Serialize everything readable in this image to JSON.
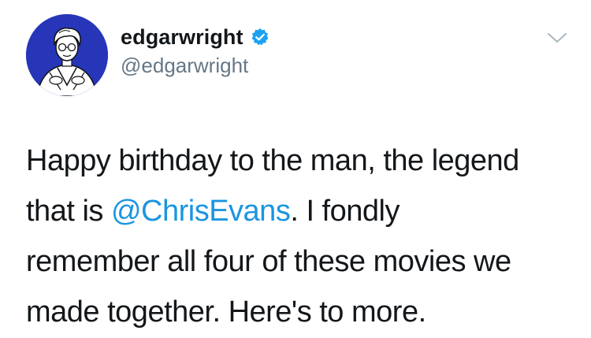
{
  "tweet": {
    "user": {
      "display_name": "edgarwright",
      "handle": "@edgarwright",
      "verified_icon": "verified-badge-icon",
      "avatar": "avatar-illustration"
    },
    "menu_icon": "chevron-down-icon",
    "text": {
      "line1": "Happy birthday to the man, the legend",
      "line2_prefix": "that is ",
      "line2_mention": "@ChrisEvans",
      "line2_suffix": ". I fondly",
      "line3": "remember all four of these movies we",
      "line4": "made together. Here's to more."
    },
    "colors": {
      "mention": "#1b95e0",
      "verified": "#1da1f2",
      "avatar_bg": "#2736b8",
      "handle": "#657786"
    }
  }
}
